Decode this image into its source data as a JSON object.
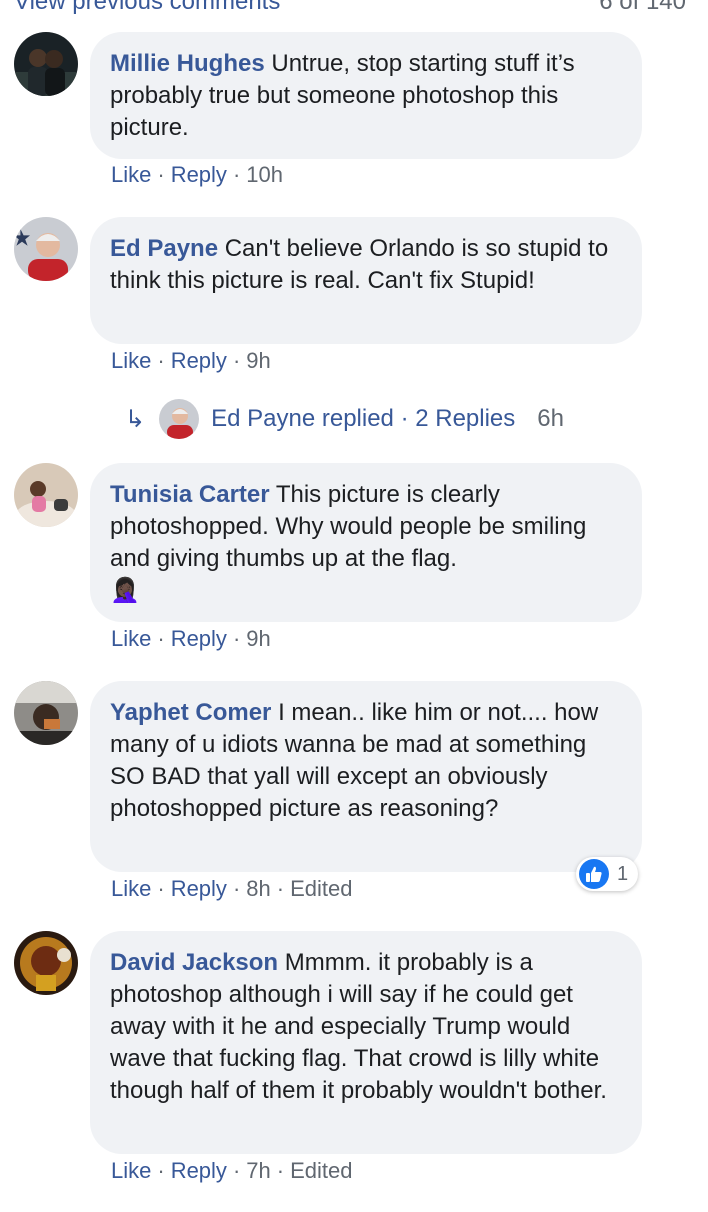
{
  "header": {
    "view_previous": "View previous comments",
    "count": "6 of 140"
  },
  "comments": [
    {
      "author": "Millie Hughes",
      "text": "Untrue, stop starting stuff it’s probably true but someone photoshop this picture.",
      "like": "Like",
      "reply": "Reply",
      "time": "10h"
    },
    {
      "author": "Ed Payne",
      "text": "Can't believe Orlando is so stupid to think this picture is real. Can't fix Stupid!",
      "like": "Like",
      "reply": "Reply",
      "time": "9h",
      "replies": {
        "author": "Ed Payne",
        "replied": "Ed Payne replied · 2 Replies",
        "time": "6h"
      }
    },
    {
      "author": "Tunisia Carter",
      "text": "This picture is clearly photoshopped. Why would people be smiling and giving thumbs up at the flag.",
      "emoji": "🤦🏿‍♀️",
      "like": "Like",
      "reply": "Reply",
      "time": "9h"
    },
    {
      "author": "Yaphet Comer",
      "text": "I mean.. like him or not.... how many of u idiots wanna be mad at something SO BAD that yall will except an obviously photoshopped picture as reasoning?",
      "like": "Like",
      "reply": "Reply",
      "time": "8h",
      "edited": "Edited",
      "reaction_count": "1"
    },
    {
      "author": "David Jackson",
      "text": "Mmmm. it probably is a photoshop although i will say if he could get away with it he and especially Trump would wave that fucking flag. That crowd is lilly white though half of them it probably wouldn't bother.",
      "like": "Like",
      "reply": "Reply",
      "time": "7h",
      "edited": "Edited"
    }
  ],
  "icons": {
    "reply_arrow": "reply-arrow-icon",
    "reaction": "thumbs-up-icon"
  },
  "colors": {
    "link": "#385898",
    "meta": "#606770",
    "bubble": "#f0f2f5",
    "like_blue": "#1877f2"
  }
}
